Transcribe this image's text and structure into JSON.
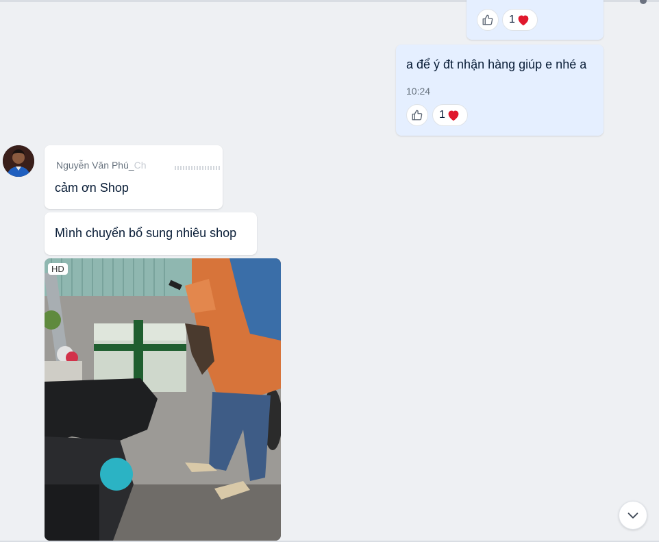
{
  "messages": {
    "outgoing_top": {
      "reaction_count": "1"
    },
    "outgoing_2": {
      "text": "a để ý đt nhận hàng giúp e nhé a",
      "time": "10:24",
      "reaction_count": "1"
    },
    "incoming_1": {
      "sender": "Nguyễn Văn Phú_",
      "sender_suffix": "Ch",
      "text": "cảm ơn Shop"
    },
    "incoming_2": {
      "text": "Mình chuyển bổ sung nhiêu shop"
    },
    "incoming_photo": {
      "badge": "HD"
    }
  },
  "icons": {
    "like": "thumbs-up-icon",
    "heart": "heart-icon",
    "scroll_down": "chevron-down-icon"
  },
  "colors": {
    "background": "#eef0f3",
    "outgoing_bubble": "#e5efff",
    "incoming_bubble": "#ffffff",
    "heart": "#e0182d",
    "text": "#081c36",
    "muted": "#67727e"
  }
}
